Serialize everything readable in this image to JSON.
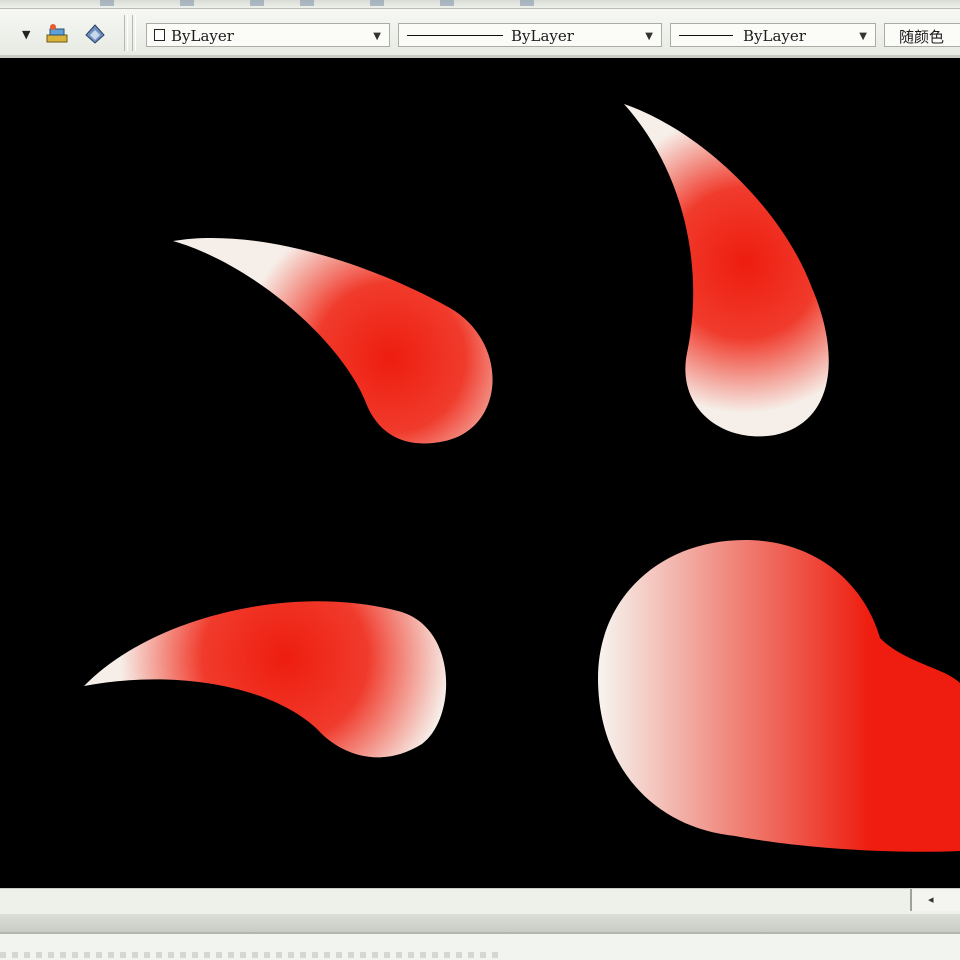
{
  "toolbar": {
    "color_control": {
      "value": "ByLayer",
      "swatch_color": "#ffffff"
    },
    "linetype_control": {
      "value": "ByLayer"
    },
    "lineweight_control": {
      "value": "ByLayer"
    },
    "plotstyle_control": {
      "value": "随颜色"
    },
    "icons": [
      "layer-states-icon",
      "layer-previous-icon"
    ]
  },
  "canvas": {
    "background": "#000000",
    "shapes": [
      {
        "name": "gradient-teardrop-top-left",
        "fill_color": "#ee1d0f",
        "highlight_color": "#f4f4f0"
      },
      {
        "name": "gradient-teardrop-top-right",
        "fill_color": "#ee1d0f",
        "highlight_color": "#f4f4f0"
      },
      {
        "name": "gradient-teardrop-bottom-left",
        "fill_color": "#ee1d0f",
        "highlight_color": "#f4f4f0"
      },
      {
        "name": "gradient-blob-bottom-right",
        "fill_color": "#ee1d0f",
        "highlight_color": "#f4f4f0"
      }
    ]
  },
  "scrollbar": {
    "arrow": "◂"
  }
}
